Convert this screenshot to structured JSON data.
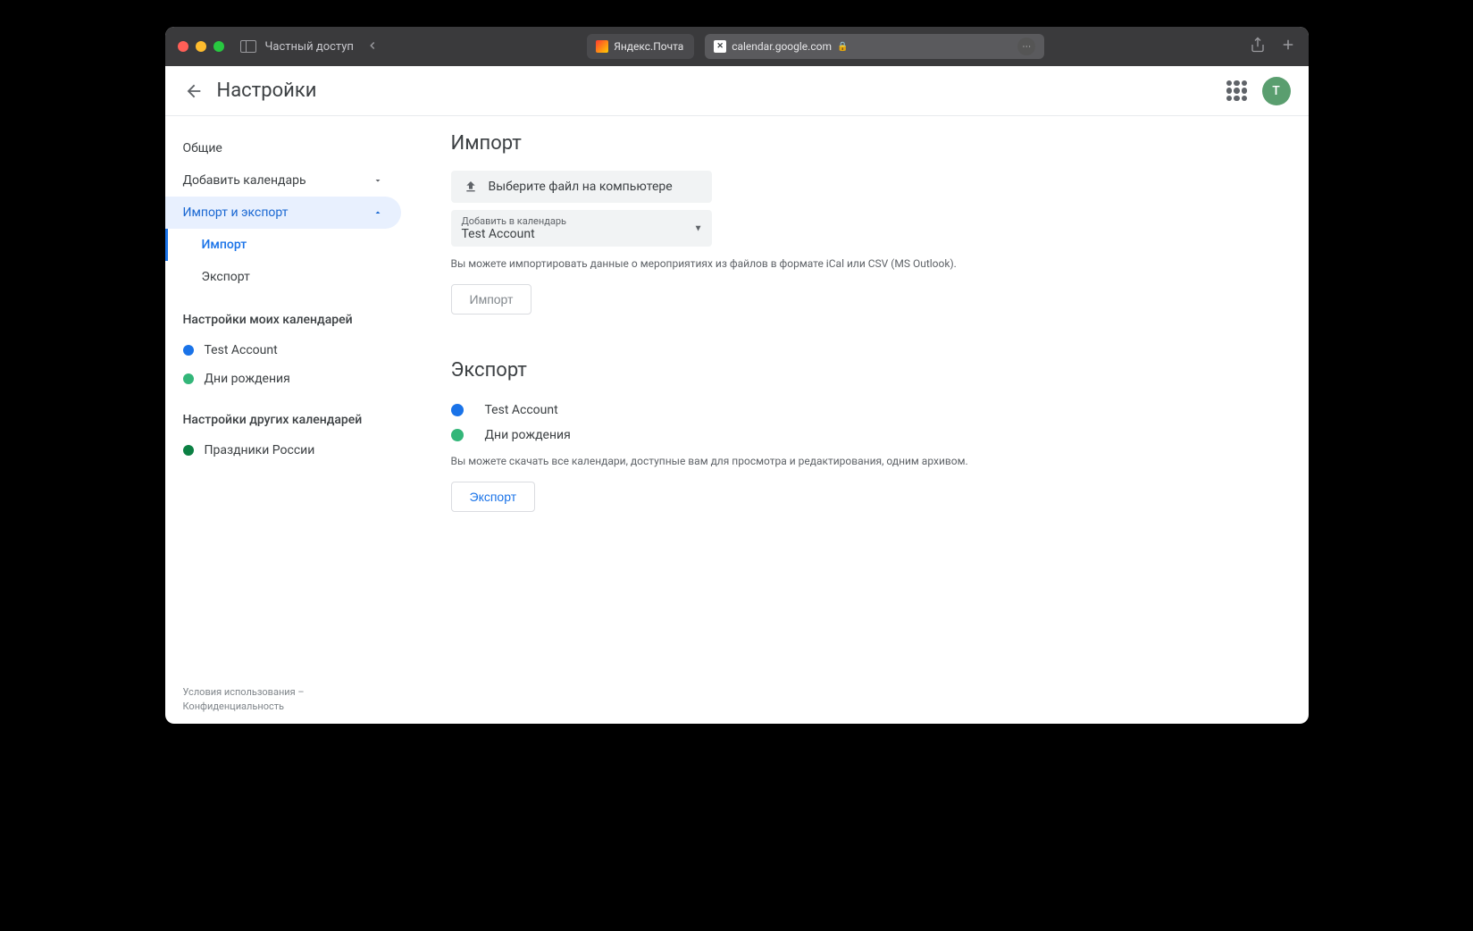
{
  "browser": {
    "private_label": "Частный доступ",
    "tabs": [
      {
        "label": "Яндекс.Почта"
      },
      {
        "label": "calendar.google.com"
      }
    ]
  },
  "header": {
    "title": "Настройки",
    "avatar_initial": "T"
  },
  "sidebar": {
    "nav": {
      "general": "Общие",
      "add_calendar": "Добавить календарь",
      "import_export": "Импорт и экспорт",
      "import": "Импорт",
      "export": "Экспорт"
    },
    "my_calendars_header": "Настройки моих календарей",
    "my_calendars": [
      {
        "label": "Test Account",
        "color": "#1a73e8"
      },
      {
        "label": "Дни рождения",
        "color": "#33b679"
      }
    ],
    "other_calendars_header": "Настройки других календарей",
    "other_calendars": [
      {
        "label": "Праздники России",
        "color": "#0b8043"
      }
    ]
  },
  "main": {
    "import": {
      "title": "Импорт",
      "file_picker": "Выберите файл на компьютере",
      "add_to_calendar_label": "Добавить в календарь",
      "selected_calendar": "Test Account",
      "help": "Вы можете импортировать данные о мероприятиях из файлов в формате iCal или CSV (MS Outlook).",
      "button": "Импорт"
    },
    "export": {
      "title": "Экспорт",
      "calendars": [
        {
          "label": "Test Account",
          "color": "#1a73e8"
        },
        {
          "label": "Дни рождения",
          "color": "#33b679"
        }
      ],
      "help": "Вы можете скачать все календари, доступные вам для просмотра и редактирования, одним архивом.",
      "button": "Экспорт"
    }
  },
  "footer": {
    "terms": "Условия использования",
    "dash": " – ",
    "privacy": "Конфиденциальность"
  }
}
